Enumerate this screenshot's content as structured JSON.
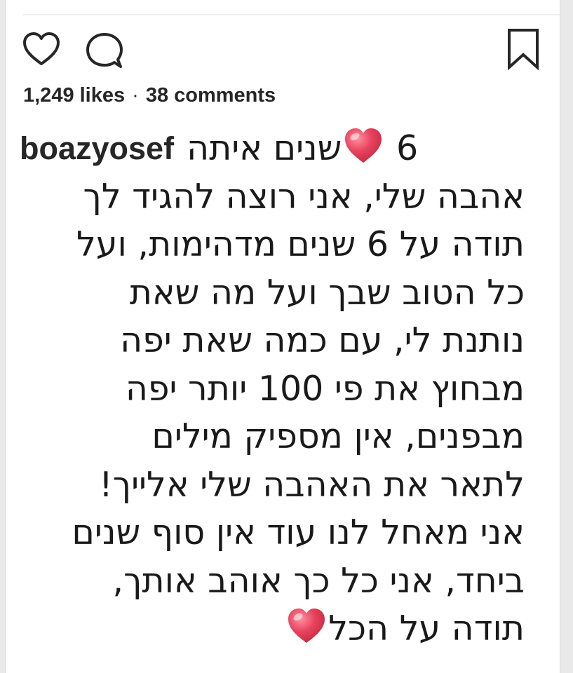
{
  "post": {
    "likes": "1,249 likes",
    "separator": "·",
    "comments": "38 comments"
  },
  "caption": {
    "username": "boazyosef",
    "first_line_before_emoji": "שנים איתה",
    "first_line_number": "6",
    "lines": [
      "אהבה שלי, אני רוצה להגיד לך",
      "תודה על 6 שנים מדהימות, ועל",
      "כל הטוב שבך ועל מה שאת",
      "נותנת לי, עם כמה שאת יפה",
      "מבחוץ את פי 100 יותר יפה",
      "מבפנים, אין מספיק מילים",
      "לתאר את האהבה שלי אלייך!",
      "אני מאחל לנו עוד אין סוף שנים",
      "ביחד, אני כל כך אוהב אותך,"
    ],
    "last_line": "תודה על הכל"
  },
  "icons": {
    "like": "heart-outline-icon",
    "comment": "comment-bubble-icon",
    "save": "bookmark-icon",
    "emoji": "red-heart-emoji"
  },
  "colors": {
    "text": "#262626",
    "heart_emoji": "#e8435e"
  }
}
